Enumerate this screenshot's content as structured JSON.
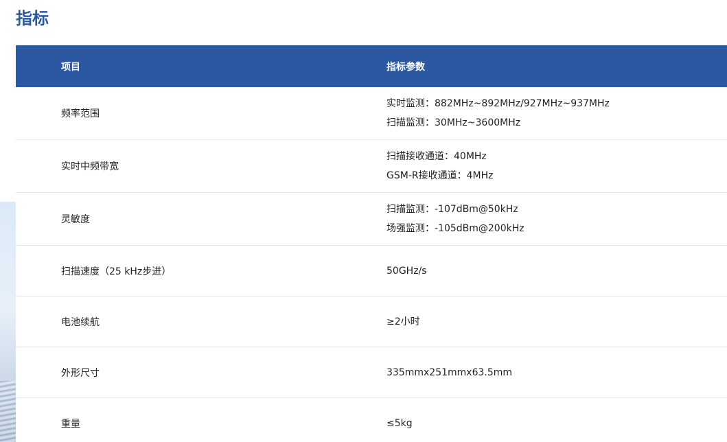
{
  "page": {
    "title": "指标"
  },
  "table": {
    "header": {
      "item": "项目",
      "param": "指标参数"
    },
    "rows": [
      {
        "item": "频率范围",
        "params": [
          "实时监测：882MHz~892MHz/927MHz~937MHz",
          "扫描监测：30MHz~3600MHz"
        ]
      },
      {
        "item": "实时中频带宽",
        "params": [
          "扫描接收通道：40MHz",
          "GSM-R接收通道：4MHz"
        ]
      },
      {
        "item": "灵敏度",
        "params": [
          "扫描监测：-107dBm@50kHz",
          "场强监测：-105dBm@200kHz"
        ]
      },
      {
        "item": "扫描速度（25 kHz步进）",
        "params": [
          "50GHz/s"
        ]
      },
      {
        "item": "电池续航",
        "params": [
          "≥2小时"
        ]
      },
      {
        "item": "外形尺寸",
        "params": [
          "335mmx251mmx63.5mm"
        ]
      },
      {
        "item": "重量",
        "params": [
          "≤5kg"
        ]
      }
    ]
  },
  "colors": {
    "accent": "#2b58a0",
    "title": "#2b59a1",
    "divider": "#e4e4e4"
  }
}
